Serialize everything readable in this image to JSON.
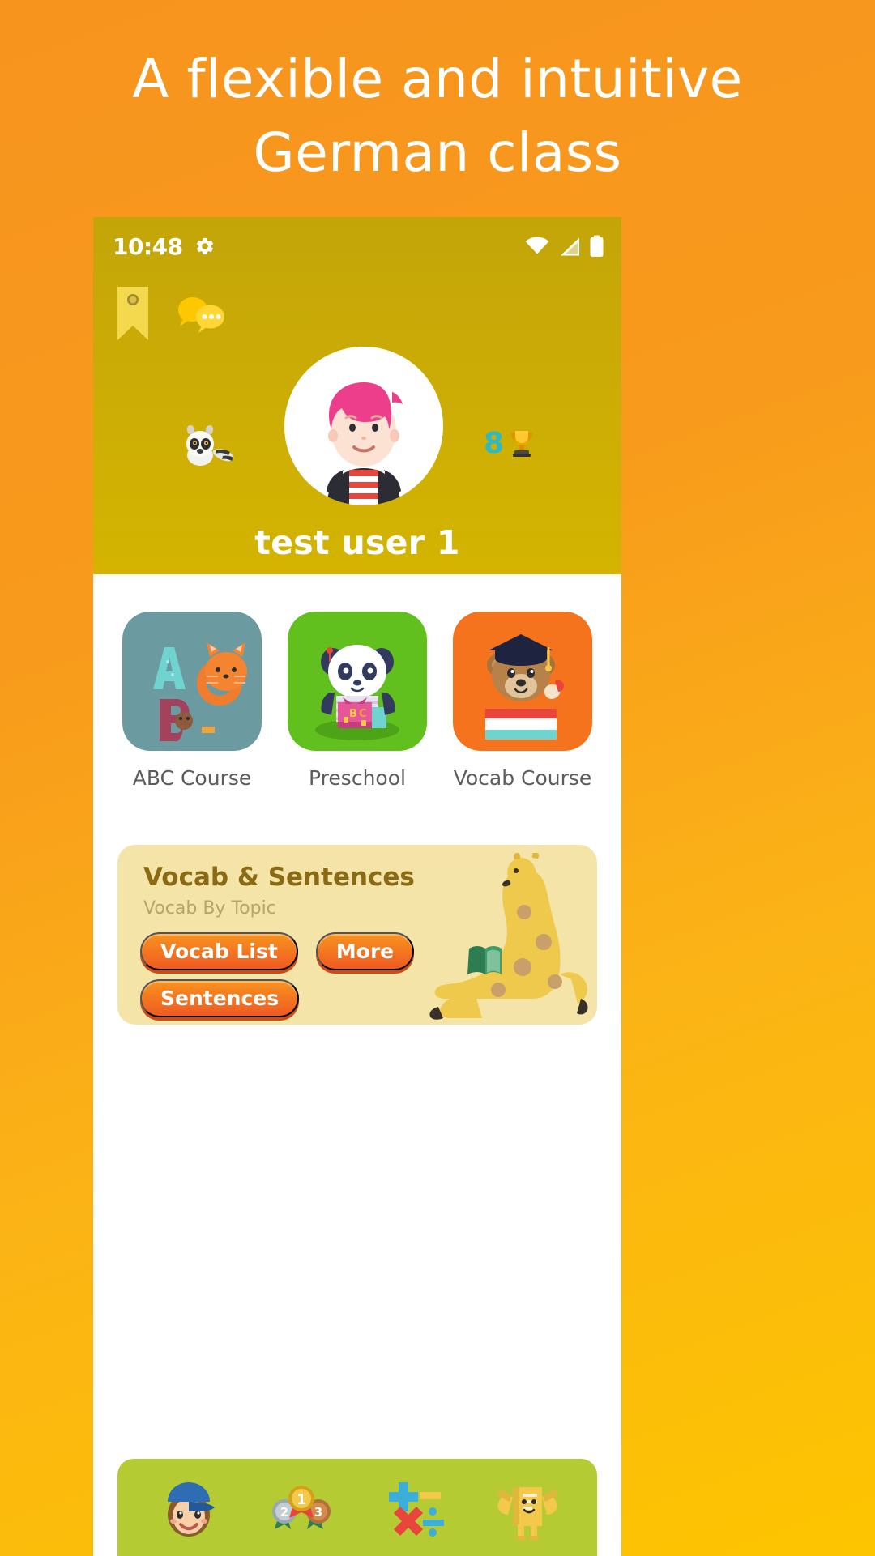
{
  "promo": {
    "headline_line1": "A flexible and intuitive",
    "headline_line2": "German class",
    "bg_color_top": "#F7941E",
    "bg_color_bottom": "#FDC500"
  },
  "statusbar": {
    "time": "10:48",
    "gear_icon": "gear-icon",
    "wifi_icon": "wifi-icon",
    "signal_icon": "cellular-signal-icon",
    "battery_icon": "battery-full-icon"
  },
  "app_header": {
    "background_color": "#CBAC06",
    "bookmark_icon": "bookmark-ribbon-icon",
    "chat_icon": "chat-bubbles-icon",
    "mascot_icon": "lemur-mascot-icon",
    "avatar_icon": "kid-avatar-pink-hair",
    "trophy_icon": "trophy-icon",
    "trophy_count": "8",
    "trophy_count_color": "#2FB9C4",
    "username": "test user 1"
  },
  "courses": [
    {
      "label": "ABC Course",
      "icon": "abc-course-icon",
      "tile_color": "#6C9AA1"
    },
    {
      "label": "Preschool",
      "icon": "preschool-panda-icon",
      "tile_color": "#62C01E"
    },
    {
      "label": "Vocab Course",
      "icon": "vocab-course-bear-icon",
      "tile_color": "#F4731C"
    }
  ],
  "vocab_card": {
    "title": "Vocab & Sentences",
    "subtitle": "Vocab By Topic",
    "card_color": "#F4E4A8",
    "title_color": "#8A6A12",
    "illustration": "giraffe-reading-icon",
    "buttons": [
      {
        "label": "Vocab List"
      },
      {
        "label": "More"
      },
      {
        "label": "Sentences"
      }
    ],
    "button_color": "#F05A22"
  },
  "bottom_nav": {
    "background_color": "#B5CB33",
    "items": [
      {
        "icon": "kid-with-cap-icon"
      },
      {
        "icon": "medals-ranking-icon"
      },
      {
        "icon": "math-symbols-icon"
      },
      {
        "icon": "book-character-icon"
      }
    ]
  }
}
